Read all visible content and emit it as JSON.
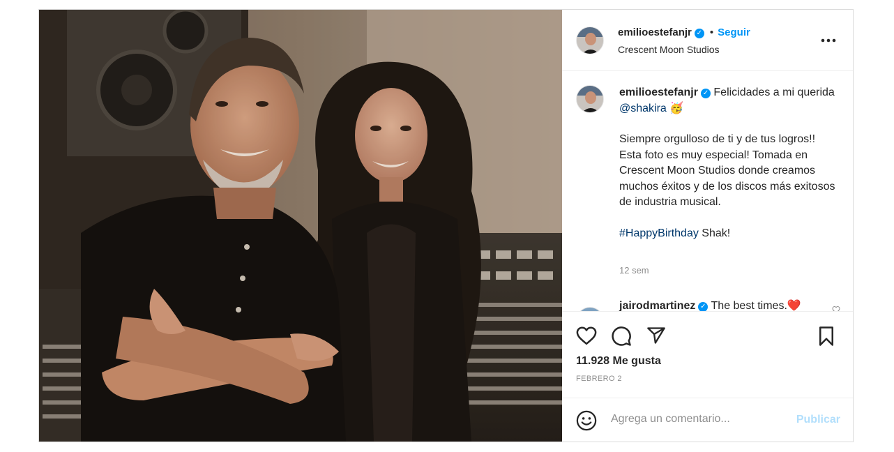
{
  "post": {
    "author": {
      "username": "emilioestefanjr",
      "verified": true,
      "follow_label": "Seguir",
      "location": "Crescent Moon Studios",
      "more_label": "•••"
    },
    "caption": {
      "username": "emilioestefanjr",
      "text_1": "Felicidades a mi querida",
      "mention": "@shakira",
      "emoji": "🥳",
      "para_1": "Siempre orgulloso de ti y de tus logros!!",
      "para_2": "Esta foto es muy especial! Tomada en Crescent Moon Studios donde creamos muchos éxitos y de los discos más exitosos de industria musical.",
      "hashtag": "#HappyBirthday",
      "hashtag_tail": "Shak!",
      "time_ago": "12 sem"
    },
    "comments": [
      {
        "username": "jairodmartinez",
        "verified": true,
        "text": "The best times.",
        "emoji": "❤️"
      }
    ],
    "actions": {
      "like_icon": "heart-outline-icon",
      "comment_icon": "comment-bubble-icon",
      "share_icon": "paper-plane-icon",
      "save_icon": "bookmark-icon"
    },
    "likes_label": "11.928 Me gusta",
    "date_label": "FEBRERO 2",
    "add_comment": {
      "emoji_icon": "smiley-icon",
      "placeholder": "Agrega un comentario...",
      "publish_label": "Publicar"
    }
  },
  "colors": {
    "link_blue": "#0095f6",
    "mention_blue": "#00376b",
    "muted": "#8e8e8e",
    "publish_disabled": "#b2dffc",
    "heart_red": "#ed4956"
  }
}
